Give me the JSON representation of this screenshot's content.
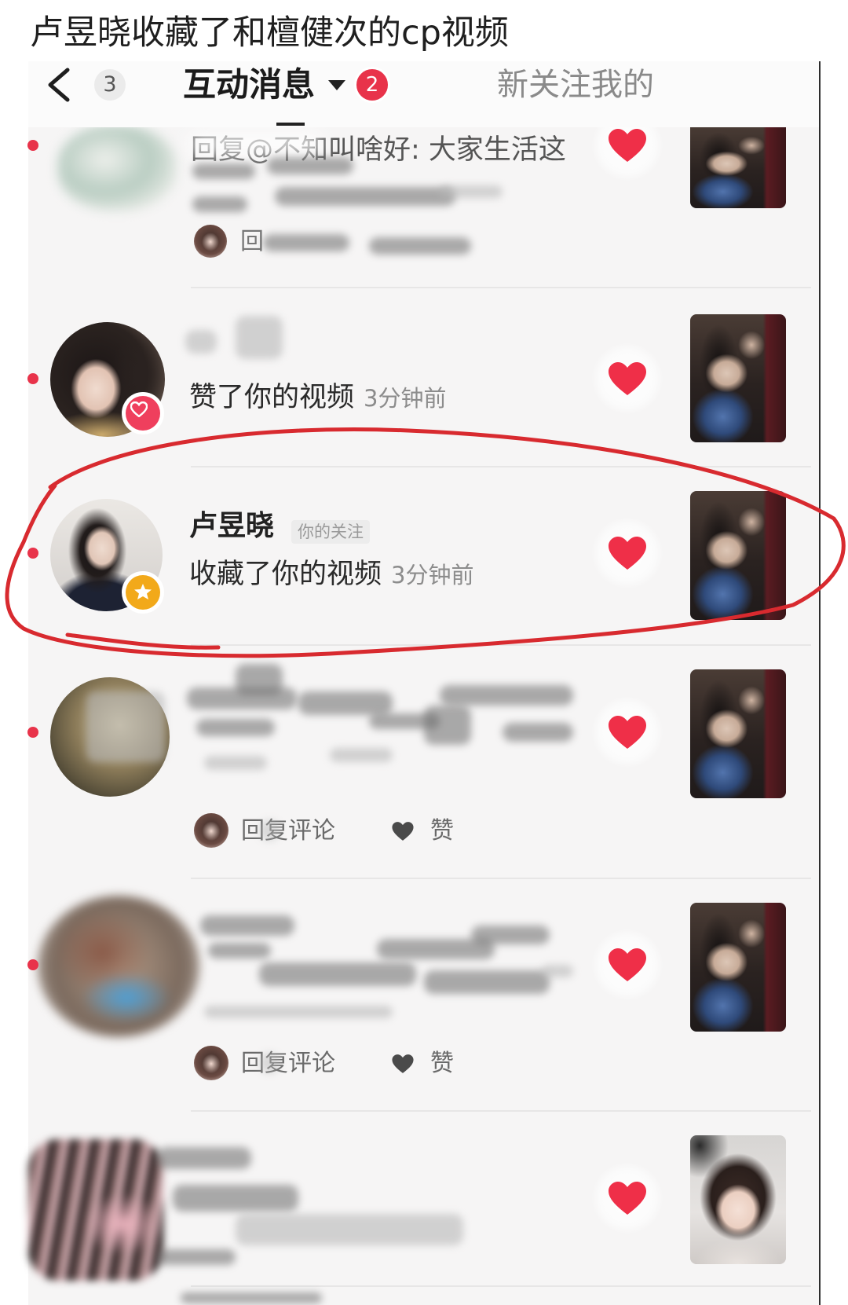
{
  "caption": "卢昱晓收藏了和檀健次的cp视频",
  "header": {
    "back_count": "3",
    "active_tab": "互动消息",
    "active_tab_badge": "2",
    "other_tab": "新关注我的"
  },
  "icons": {
    "back": "chevron-left-icon",
    "tab_dropdown": "caret-down-icon",
    "like_button": "heart-icon",
    "reply_like": "heart-icon"
  },
  "colors": {
    "like_heart": "#ef2f48",
    "unread_dot": "#e8334a",
    "tab_badge": "#e8334a",
    "favorite_badge": "#f2a91a",
    "like_badge": "#ef3f5d",
    "annotation": "#d82a2f",
    "inactive_tab": "#8a8a8a"
  },
  "items": [
    {
      "preview": "回复@不知叫啥好: 大家生活这",
      "reply_label": "回"
    },
    {
      "action": "赞了你的视频",
      "time": "3分钟前",
      "avatar_badge": "heart-badge-icon"
    },
    {
      "name": "卢昱晓",
      "tag": "你的关注",
      "action": "收藏了你的视频",
      "time": "3分钟前",
      "avatar_badge": "star-badge-icon"
    },
    {
      "reply_label": "回复评论",
      "like_label": "赞"
    },
    {
      "reply_label": "回复评论",
      "like_label": "赞"
    }
  ]
}
